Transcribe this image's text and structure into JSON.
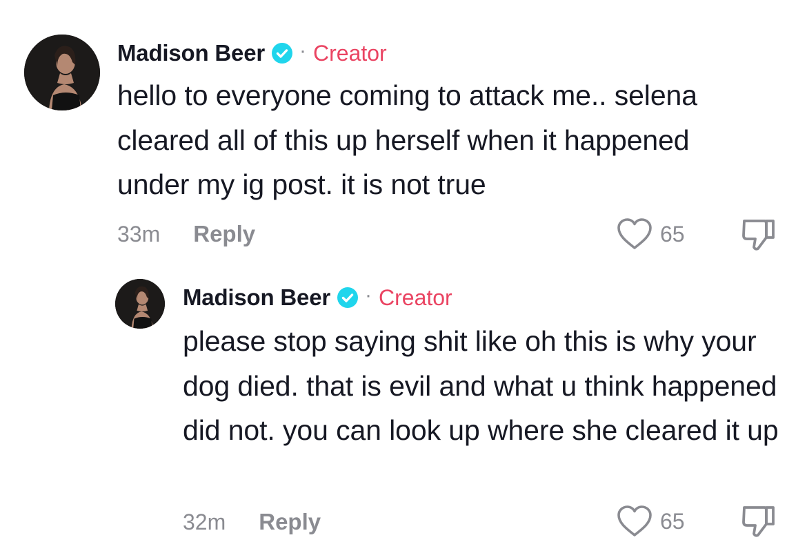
{
  "comments": [
    {
      "username": "Madison Beer",
      "badge_separator": "·",
      "role": "Creator",
      "text": "hello to everyone coming to attack me.. selena cleared all of this up herself when it happened under my ig post. it is not true",
      "time": "33m",
      "reply_label": "Reply",
      "like_count": "65",
      "icons": {
        "avatar": "avatar",
        "verified": "verified-icon",
        "like": "heart-icon",
        "dislike": "thumbs-down-icon"
      }
    },
    {
      "username": "Madison Beer",
      "badge_separator": "·",
      "role": "Creator",
      "text": "please stop saying shit like oh this is why your dog died. that is evil and what u think happened did not. you can look up where she cleared it up",
      "time": "32m",
      "reply_label": "Reply",
      "like_count": "65",
      "icons": {
        "avatar": "avatar",
        "verified": "verified-icon",
        "like": "heart-icon",
        "dislike": "thumbs-down-icon"
      }
    }
  ],
  "colors": {
    "text": "#161823",
    "muted": "#8a8b91",
    "creator": "#ea4462",
    "verified": "#20d5ec"
  }
}
